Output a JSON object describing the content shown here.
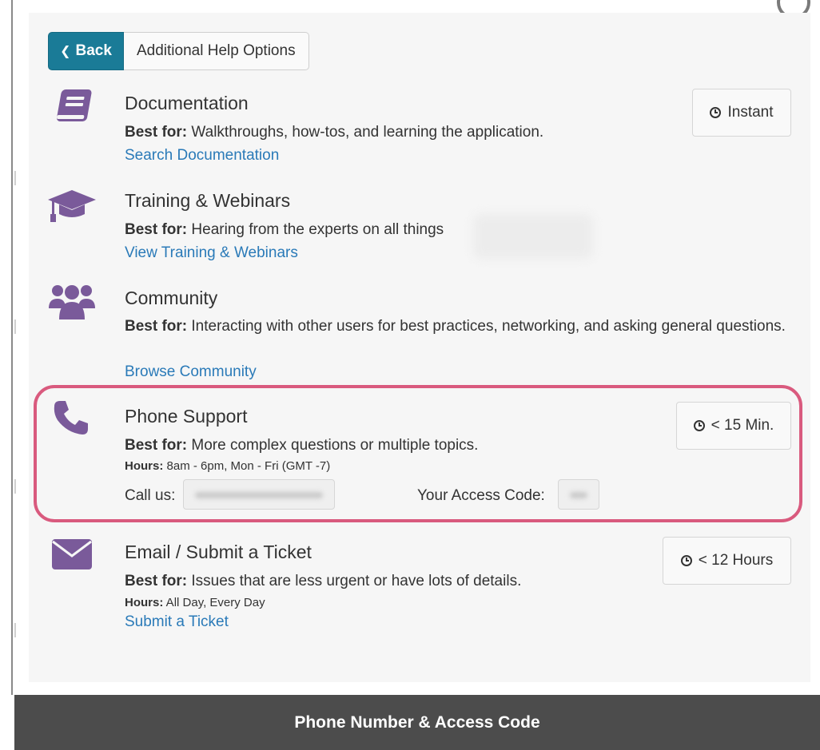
{
  "header": {
    "back_label": "Back",
    "help_options_label": "Additional Help Options"
  },
  "options": [
    {
      "icon": "book-icon",
      "title": "Documentation",
      "best_for_label": "Best for:",
      "best_for": " Walkthroughs, how-tos, and learning the application.",
      "link": "Search Documentation",
      "time": "Instant"
    },
    {
      "icon": "graduation-cap-icon",
      "title": "Training & Webinars",
      "best_for_label": "Best for:",
      "best_for": " Hearing from the experts on all things",
      "link": "View Training & Webinars"
    },
    {
      "icon": "users-icon",
      "title": "Community",
      "best_for_label": "Best for:",
      "best_for": " Interacting with other users for best practices, networking, and asking general questions.",
      "link": "Browse Community"
    },
    {
      "icon": "phone-icon",
      "title": "Phone Support",
      "best_for_label": "Best for:",
      "best_for": " More complex questions or multiple topics.",
      "hours_label": "Hours:",
      "hours": " 8am - 6pm, Mon - Fri (GMT -7)",
      "call_label": "Call us:",
      "access_label": "Your Access Code:",
      "time": "< 15 Min."
    },
    {
      "icon": "envelope-icon",
      "title": "Email / Submit a Ticket",
      "best_for_label": "Best for:",
      "best_for": " Issues that are less urgent or have lots of details.",
      "hours_label": "Hours:",
      "hours": " All Day, Every Day",
      "link": "Submit a Ticket",
      "time": "< 12 Hours"
    }
  ],
  "colors": {
    "accent_purple": "#7a5a9a",
    "back_button": "#1a7b97",
    "link": "#2a7ab8",
    "highlight": "#d95a7e",
    "footer": "#4c4c4c"
  },
  "footer": {
    "caption": "Phone Number & Access Code"
  }
}
